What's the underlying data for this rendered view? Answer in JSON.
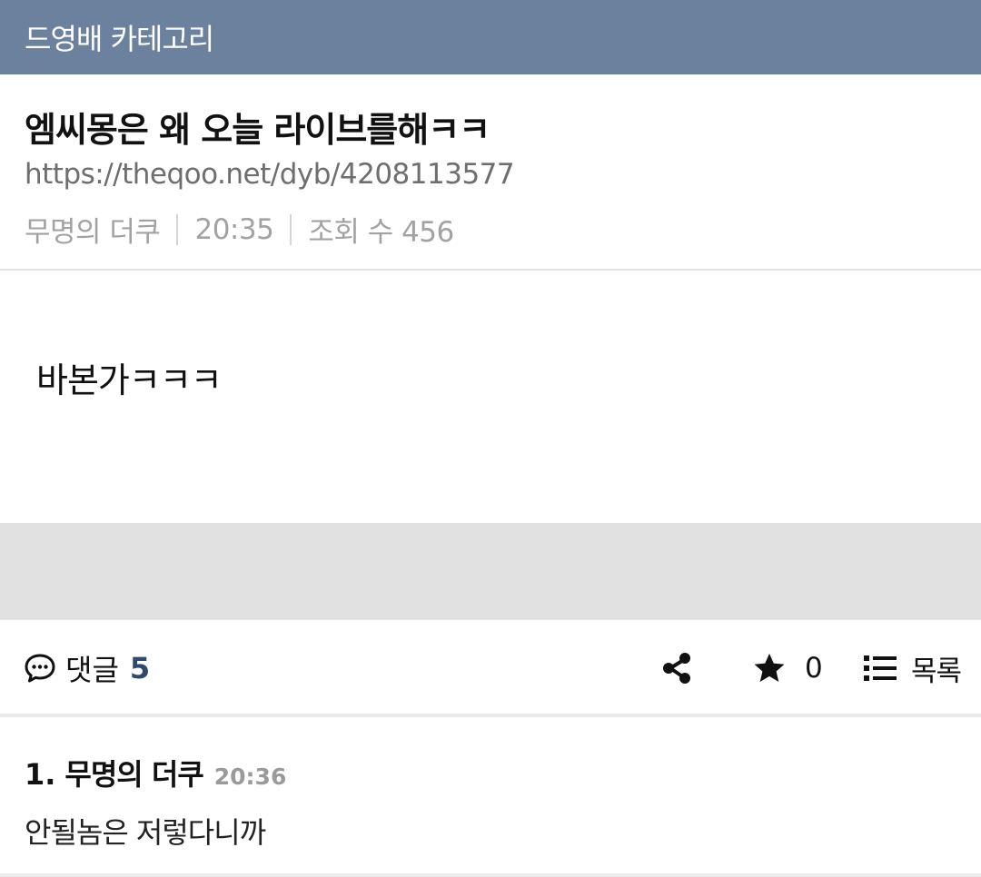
{
  "header": {
    "category_title": "드영배 카테고리"
  },
  "post": {
    "title": "엠씨몽은 왜 오늘 라이브를해ㅋㅋ",
    "url": "https://theqoo.net/dyb/4208113577",
    "author": "무명의 더쿠",
    "time": "20:35",
    "views": "조회 수 456",
    "body": "바본가ㅋㅋㅋ"
  },
  "actions": {
    "comments_label": "댓글",
    "comments_count": "5",
    "star_count": "0",
    "list_label": "목록",
    "icons": {
      "comments": "comment-bubble-icon",
      "share": "share-icon",
      "star": "star-icon",
      "list": "list-icon"
    }
  },
  "comments": [
    {
      "number": "1.",
      "author": "무명의 더쿠",
      "time": "20:36",
      "text": "안될놈은 저렇다니까"
    }
  ],
  "colors": {
    "header_bg": "#6b819e",
    "gray_band": "#e1e1e1",
    "comment_count": "#2e4a6a",
    "meta_text": "#a2a2a2"
  }
}
